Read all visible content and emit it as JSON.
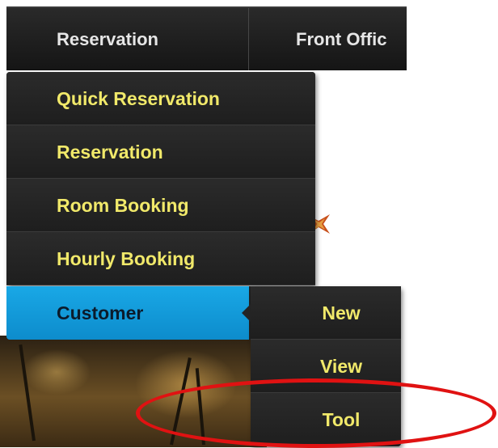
{
  "nav": {
    "tabs": [
      {
        "label": "Reservation"
      },
      {
        "label": "Front Offic"
      }
    ]
  },
  "reservation_menu": {
    "items": [
      {
        "label": "Quick Reservation"
      },
      {
        "label": "Reservation"
      },
      {
        "label": "Room Booking"
      },
      {
        "label": "Hourly Booking"
      }
    ],
    "active_item": {
      "label": "Customer"
    }
  },
  "customer_submenu": {
    "items": [
      {
        "label": "New"
      },
      {
        "label": "View"
      },
      {
        "label": "Tool"
      }
    ]
  },
  "colors": {
    "menu_text": "#f1e96a",
    "menu_bg": "#222222",
    "active_bg": "#0d8ccc",
    "annotation": "#e01212"
  }
}
